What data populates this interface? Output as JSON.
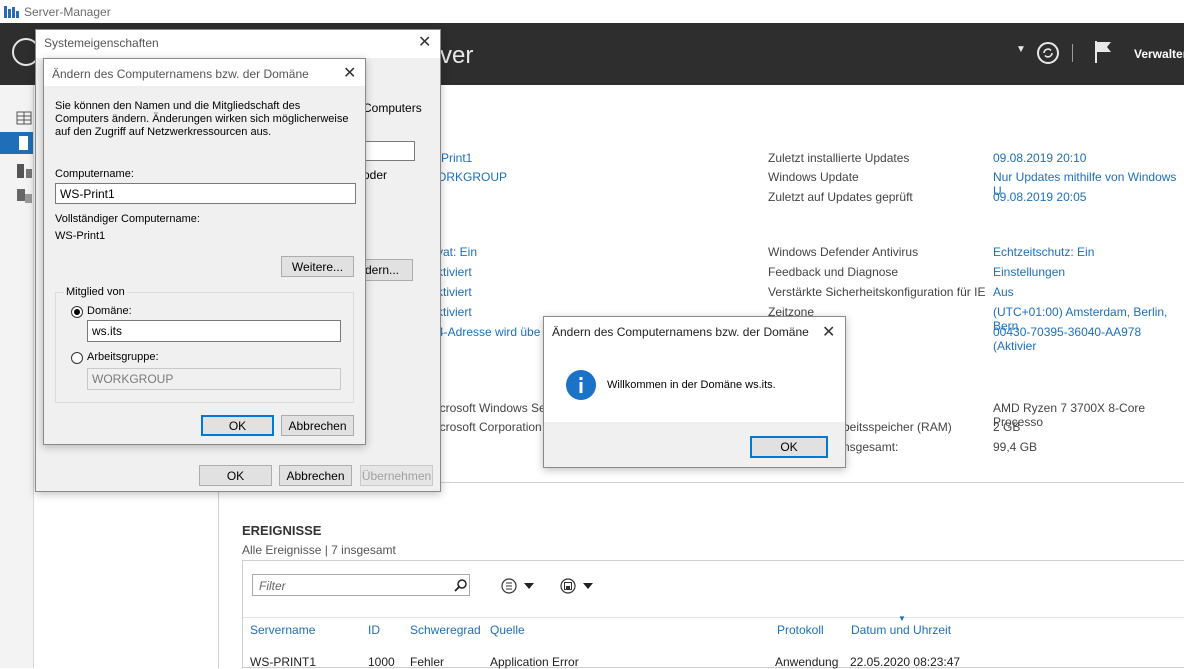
{
  "window": {
    "title": "Server-Manager"
  },
  "header": {
    "title_fragment": "ver",
    "menu_fragment": "Verwalter"
  },
  "properties": {
    "left_links": [
      "-Print1",
      "ORKGROUP"
    ],
    "left_links2": [
      "vat: Ein",
      "ktiviert",
      "ktiviert",
      "ktiviert",
      "4-Adresse wird übe"
    ],
    "left_plain": [
      "icrosoft Windows Se",
      "icrosoft Corporation"
    ],
    "right_keys1": [
      "Zuletzt installierte Updates",
      "Windows Update",
      "Zuletzt auf Updates geprüft"
    ],
    "right_vals1": [
      "09.08.2019 20:10",
      "Nur Updates mithilfe von Windows U",
      "09.08.2019 20:05"
    ],
    "right_keys2": [
      "Windows Defender Antivirus",
      "Feedback und Diagnose",
      "Verstärkte Sicherheitskonfiguration für IE",
      "Zeitzone"
    ],
    "right_vals2": [
      "Echtzeitschutz: Ein",
      "Einstellungen",
      "Aus",
      "(UTC+01:00) Amsterdam, Berlin, Bern",
      "00430-70395-36040-AA978 (Aktivier"
    ],
    "right_keys3": [
      "beitsspeicher (RAM)",
      "nsgesamt:"
    ],
    "right_vals3": [
      "AMD Ryzen 7 3700X 8-Core Processo",
      "2 GB",
      "99,4 GB"
    ]
  },
  "events": {
    "title": "EREIGNISSE",
    "subtitle": "Alle Ereignisse | 7 insgesamt",
    "filter_placeholder": "Filter",
    "columns": [
      "Servername",
      "ID",
      "Schweregrad",
      "Quelle",
      "Protokoll",
      "Datum und Uhrzeit"
    ],
    "rows": [
      [
        "WS-PRINT1",
        "1000",
        "Fehler",
        "Application Error",
        "Anwendung",
        "22.05.2020 08:23:47"
      ]
    ]
  },
  "sysprops": {
    "title": "Systemeigenschaften",
    "behind_fragments": [
      "Computers",
      "oder",
      "dern..."
    ],
    "ok": "OK",
    "cancel": "Abbrechen",
    "apply": "Übernehmen"
  },
  "rename": {
    "title": "Ändern des Computernamens bzw. der Domäne",
    "description": "Sie können den Namen und die Mitgliedschaft des Computers ändern. Änderungen wirken sich möglicherweise auf den Zugriff auf Netzwerkressourcen aus.",
    "computer_name_label": "Computername:",
    "computer_name_value": "WS-Print1",
    "full_name_label": "Vollständiger Computername:",
    "full_name_value": "WS-Print1",
    "more_button": "Weitere...",
    "member_of_label": "Mitglied von",
    "domain_label": "Domäne:",
    "domain_value": "ws.its",
    "workgroup_label": "Arbeitsgruppe:",
    "workgroup_value": "WORKGROUP",
    "ok": "OK",
    "cancel": "Abbrechen"
  },
  "welcome": {
    "title": "Ändern des Computernamens bzw. der Domäne",
    "message": "Willkommen in der Domäne ws.its.",
    "ok": "OK"
  },
  "colors": {
    "header_bg": "#2e2e2e",
    "link": "#1e6fb8",
    "accent": "#0078d7",
    "info_icon": "#1a73c7"
  },
  "icons": [
    "app-icon",
    "back-icon",
    "dropdown-arrow-icon",
    "refresh-icon",
    "flag-icon",
    "dashboard-icon",
    "local-server-icon",
    "all-servers-icon",
    "file-services-icon",
    "close-icon",
    "info-icon",
    "search-icon",
    "list-view-icon",
    "save-icon"
  ]
}
